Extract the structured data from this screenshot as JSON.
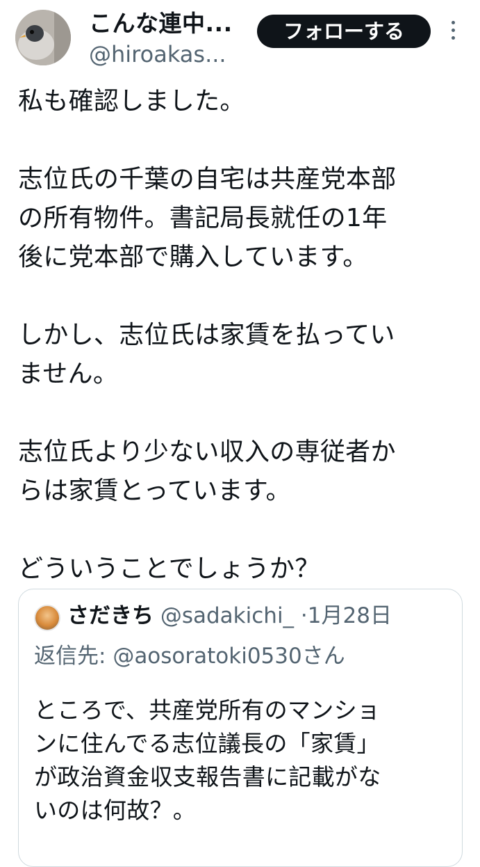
{
  "author": {
    "display_name": "こんな連中...",
    "handle": "@hiroakas...",
    "follow_label": "フォローする",
    "avatar_icon": "profile-photo-bird"
  },
  "tweet": {
    "lines": [
      "私も確認しました。",
      "",
      "志位氏の千葉の自宅は共産党本部",
      "の所有物件。書記局長就任の1年",
      "後に党本部で購入しています。",
      "",
      "しかし、志位氏は家賃を払ってい",
      "ません。",
      "",
      "志位氏より少ない収入の専従者か",
      "らは家賃とっています。",
      "",
      "どういうことでしょうか？"
    ]
  },
  "quoted_tweet": {
    "display_name": "さだきち",
    "handle": "@sadakichi_",
    "separator": "·",
    "date": "1月28日",
    "reply_prefix": "返信先: ",
    "reply_to": "@aosoratoki0530さん",
    "lines": [
      "ところで、共産党所有のマンショ",
      "ンに住んでる志位議長の「家賃」",
      "が政治資金収支報告書に記載がな",
      "いのは何故？。"
    ]
  },
  "colors": {
    "text": "#0f1419",
    "secondary": "#536471",
    "border": "#cfd9de",
    "follow_bg": "#0f1419"
  }
}
